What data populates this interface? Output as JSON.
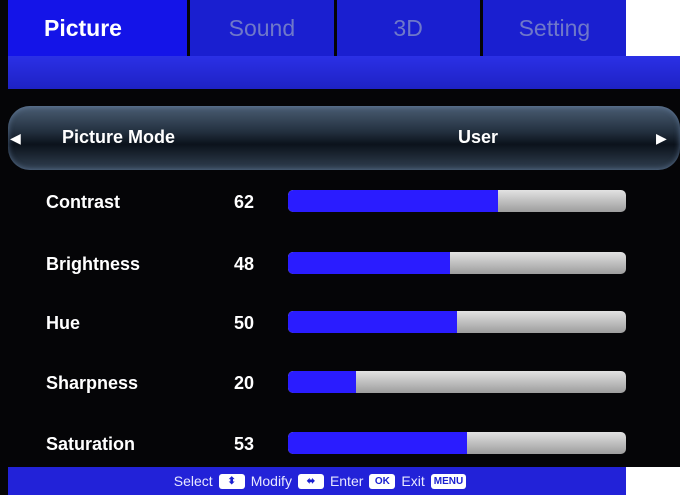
{
  "tabs": [
    {
      "label": "Picture",
      "active": true
    },
    {
      "label": "Sound",
      "active": false
    },
    {
      "label": "3D",
      "active": false
    },
    {
      "label": "Setting",
      "active": false
    }
  ],
  "picture_mode": {
    "label": "Picture Mode",
    "value": "User",
    "left_icon": "triangle-left-icon",
    "right_icon": "triangle-right-icon"
  },
  "settings": [
    {
      "label": "Contrast",
      "value": "62",
      "level": 0.62
    },
    {
      "label": "Brightness",
      "value": "48",
      "level": 0.48
    },
    {
      "label": "Hue",
      "value": "50",
      "level": 0.5
    },
    {
      "label": "Sharpness",
      "value": "20",
      "level": 0.2
    },
    {
      "label": "Saturation",
      "value": "53",
      "level": 0.53
    }
  ],
  "footer": {
    "select": "Select",
    "modify": "Modify",
    "enter": "Enter",
    "ok_key": "OK",
    "exit": "Exit",
    "menu_key": "MENU",
    "select_icon": "up-down-icon",
    "modify_icon": "left-right-icon"
  },
  "colors": {
    "tab_active": "#1414e8",
    "tab_inactive": "#1a1fd0",
    "slider_fill": "#2a1cff",
    "slider_track": "#bdbdbd"
  }
}
